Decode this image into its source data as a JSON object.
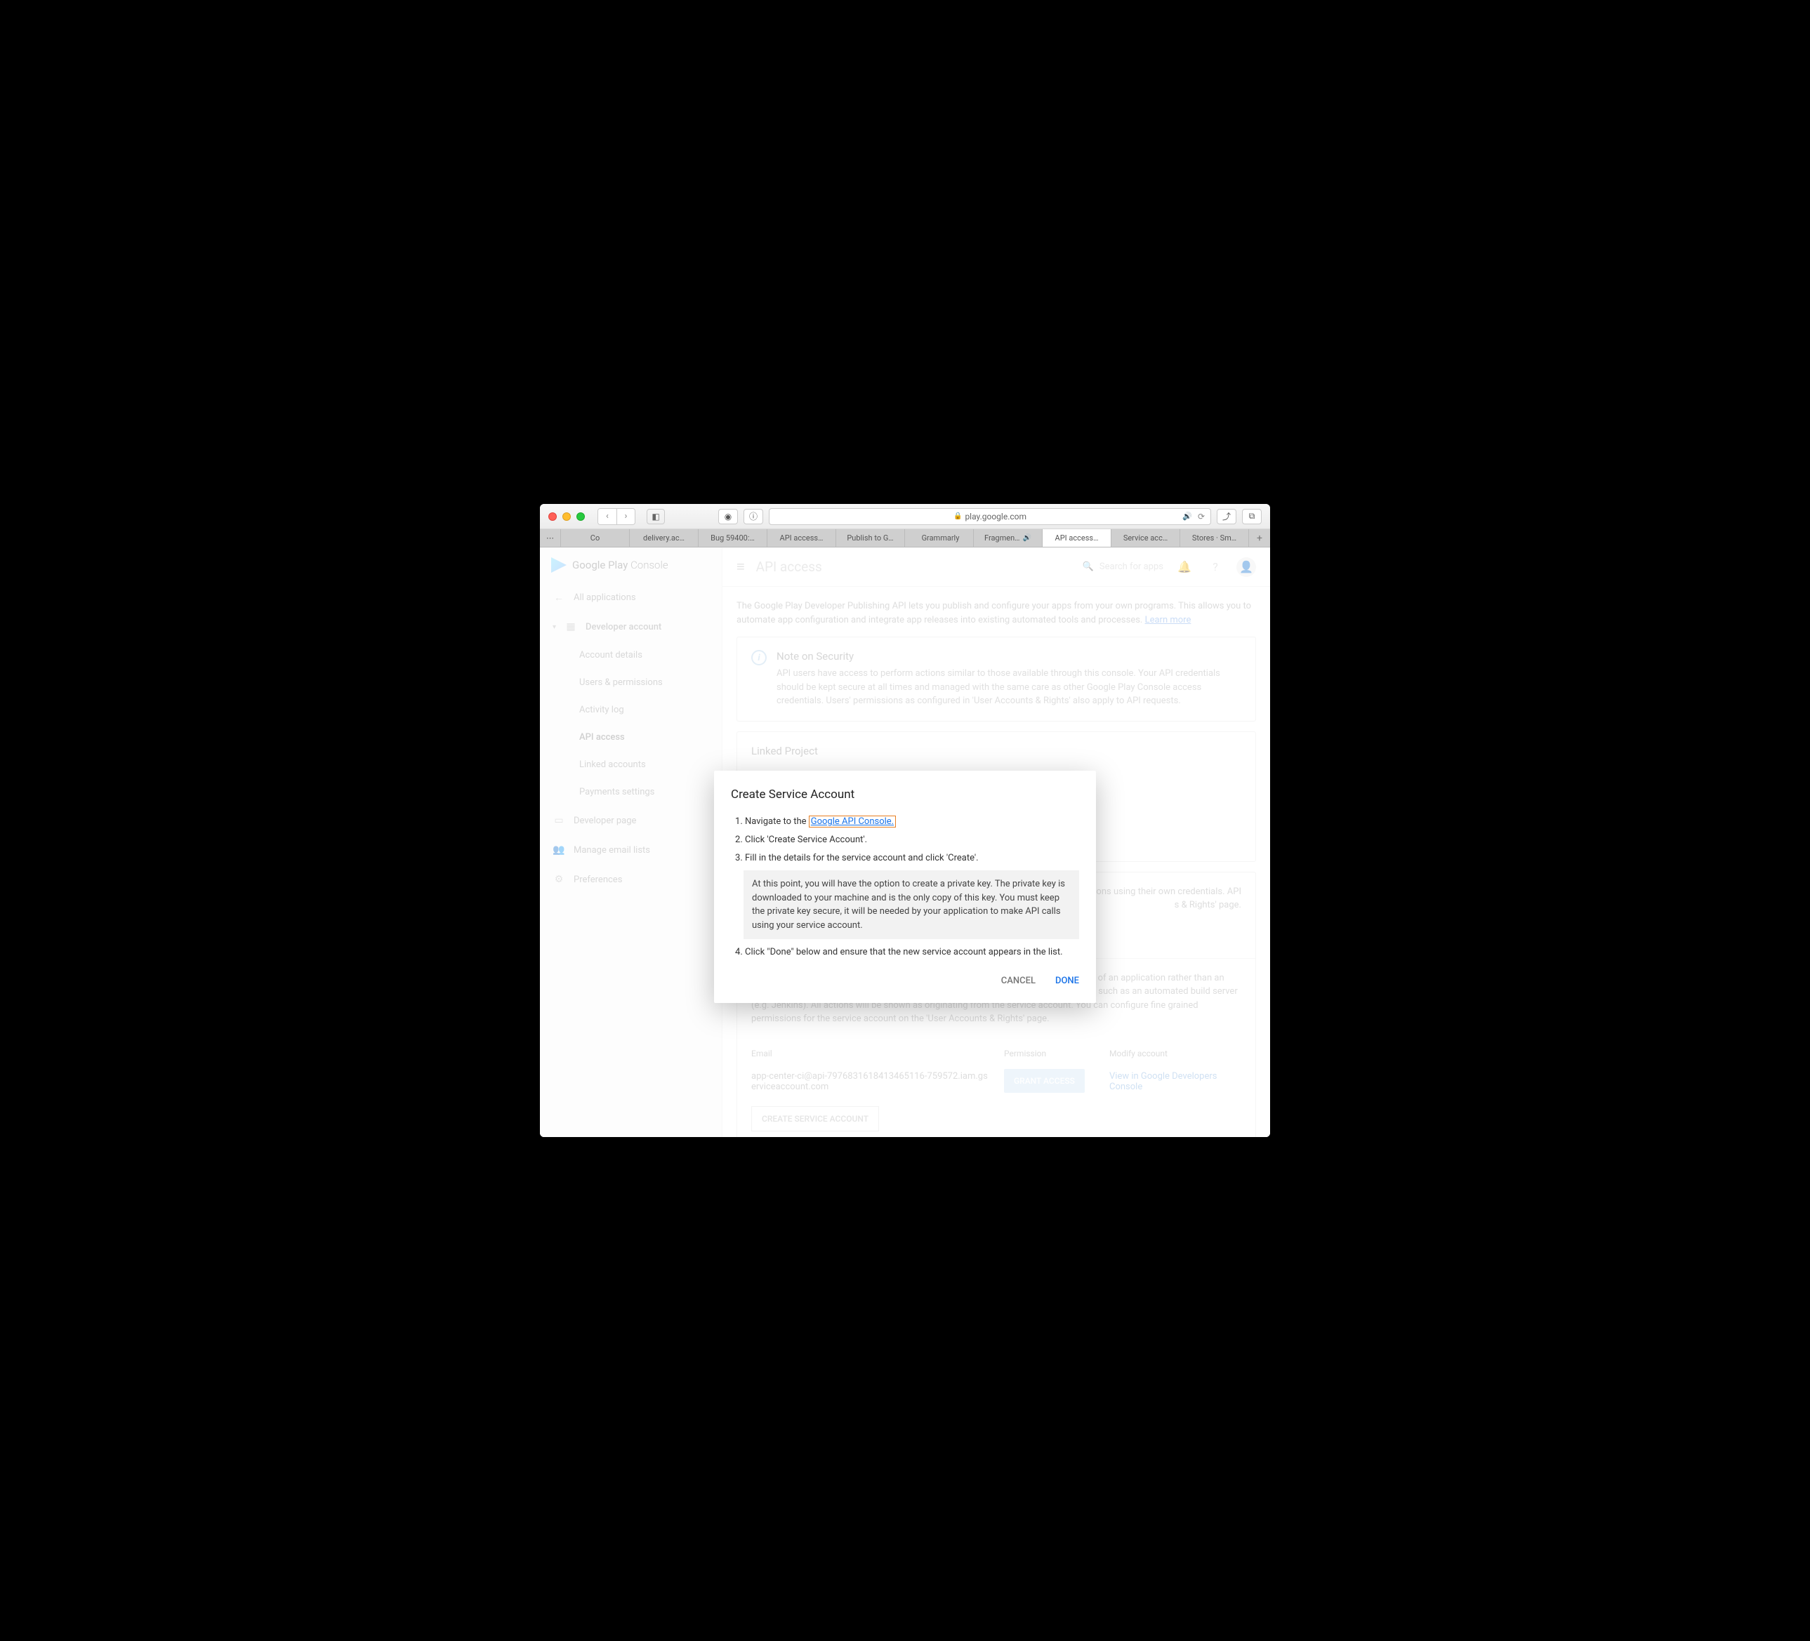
{
  "browser": {
    "url_host": "play.google.com",
    "tabs": [
      "Co",
      "delivery.ac…",
      "Bug 59400:…",
      "API access…",
      "Publish to G…",
      "Grammarly",
      "Fragmen…",
      "API access…",
      "Service acc…",
      "Stores · Sm…"
    ],
    "active_tab_index": 7,
    "audio_tab_index": 6
  },
  "logo_text_a": "Google Play ",
  "logo_text_b": "Console",
  "sidebar": {
    "all_apps": "All applications",
    "dev_account": "Developer account",
    "subs": [
      "Account details",
      "Users & permissions",
      "Activity log",
      "API access",
      "Linked accounts",
      "Payments settings"
    ],
    "active_sub_index": 3,
    "dev_page": "Developer page",
    "manage_email": "Manage email lists",
    "prefs": "Preferences"
  },
  "appbar": {
    "title": "API access",
    "search_placeholder": "Search for apps"
  },
  "intro": {
    "text": "The Google Play Developer Publishing API lets you publish and configure your apps from your own programs. This allows you to automate app configuration and integrate app releases into existing automated tools and processes. ",
    "learn": "Learn more"
  },
  "note": {
    "title": "Note on Security",
    "body": "API users have access to perform actions similar to those available through this console. Your API credentials should be kept secure at all times and managed with the same care as other Google Play Console access credentials. Users' permissions as configured in 'User Accounts & Rights' also apply to API requests."
  },
  "linked": {
    "title": "Linked Project"
  },
  "users_section": {
    "body1": "actions using their own credentials. API",
    "body2": "s & Rights' page."
  },
  "sa_section": {
    "body": "Service accounts allow access to the Google Play Developer Publishing API on behalf of an application rather than an end user. Service accounts are ideal for accessing the API from an unattended server, such as an automated build server (e.g. Jenkins). All actions will be shown as originating from the service account. You can configure fine grained permissions for the service account on the 'User Accounts & Rights' page.",
    "hdr_email": "Email",
    "hdr_perm": "Permission",
    "hdr_mod": "Modify account",
    "row_email": "app-center-ci@api-7976831618413465116-759572.iam.gserviceaccount.com",
    "grant": "GRANT ACCESS",
    "view_link": "View in Google Developers Console",
    "create_btn": "CREATE SERVICE ACCOUNT"
  },
  "modal": {
    "title": "Create Service Account",
    "step1_a": "Navigate to the ",
    "step1_link": "Google API Console.",
    "step2": "Click 'Create Service Account'.",
    "step3": "Fill in the details for the service account and click 'Create'.",
    "callout": "At this point, you will have the option to create a private key. The private key is downloaded to your machine and is the only copy of this key. You must keep the private key secure, it will be needed by your application to make API calls using your service account.",
    "step4": "Click \"Done\" below and ensure that the new service account appears in the list.",
    "cancel": "CANCEL",
    "done": "DONE"
  }
}
